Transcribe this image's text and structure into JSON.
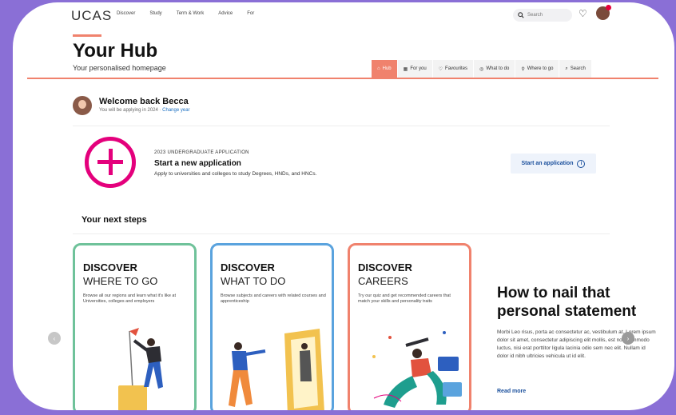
{
  "nav": {
    "logo": "UCAS",
    "items": [
      "Discover",
      "Study",
      "Term & Work",
      "Advice",
      "For"
    ],
    "search_placeholder": "Search"
  },
  "header": {
    "title": "Your Hub",
    "subtitle": "Your personalised homepage",
    "tabs": [
      {
        "label": "Hub",
        "icon": "home-icon",
        "active": true
      },
      {
        "label": "For you",
        "icon": "grid-icon",
        "active": false
      },
      {
        "label": "Favourites",
        "icon": "heart-icon",
        "active": false
      },
      {
        "label": "What to do",
        "icon": "compass-icon",
        "active": false
      },
      {
        "label": "Where to go",
        "icon": "pin-icon",
        "active": false
      },
      {
        "label": "Search",
        "icon": "search-icon",
        "active": false
      }
    ]
  },
  "welcome": {
    "greeting": "Welcome back Becca",
    "applying": "You will be applying in 2024 ·",
    "change_link": "Change year"
  },
  "application": {
    "kicker": "2023 UNDERGRADUATE APPLICATION",
    "title": "Start a new application",
    "description": "Apply to universities and colleges to study Degrees, HNDs, and HNCs.",
    "button": "Start an application",
    "accent": "#e4007c"
  },
  "next_steps": {
    "heading": "Your next steps",
    "cards": [
      {
        "kicker": "DISCOVER",
        "title": "WHERE TO GO",
        "description": "Browse all our regions and learn what it's like at Universities, colleges and employers",
        "border": "#6fc29a"
      },
      {
        "kicker": "DISCOVER",
        "title": "WHAT TO DO",
        "description": "Browse subjects and careers with related courses and apprenticeship",
        "border": "#5aa3de"
      },
      {
        "kicker": "DISCOVER",
        "title": "CAREERS",
        "description": "Try our quiz and get recommended careers that match your skills and personality traits",
        "border": "#f0826d"
      }
    ]
  },
  "article": {
    "title": "How to nail that personal statement",
    "body": "Morbi Leo risus, porta ac consectetur ac, vestibulum at. Lorem ipsum dolor sit amet, consectetur adipiscing elit mollis, est non commodo luctus, nisi erat porttitor ligula lacinia odio sem nec elit. Nullam id dolor id nibh ultricies vehicula ut id elit.",
    "link": "Read more"
  },
  "colors": {
    "accent": "#f0826d",
    "background": "#8a6fd6"
  }
}
